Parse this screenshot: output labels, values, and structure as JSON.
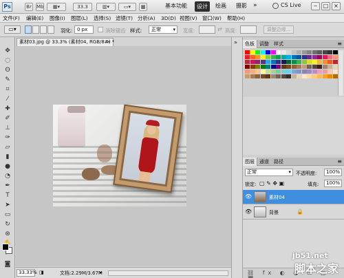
{
  "app": {
    "logo": "Ps"
  },
  "titlebar": {
    "zoom": "33.3",
    "workspaces": [
      "基本功能",
      "设计",
      "绘画",
      "摄影"
    ],
    "active_workspace": "设计",
    "overflow": "»",
    "cs_live": "CS Live",
    "controls": [
      "‒",
      "□",
      "×"
    ]
  },
  "menubar": {
    "items": [
      "文件(F)",
      "编辑(E)",
      "图像(I)",
      "图层(L)",
      "选择(S)",
      "滤镜(T)",
      "分析(A)",
      "3D(D)",
      "视图(V)",
      "窗口(W)",
      "帮助(H)"
    ]
  },
  "options": {
    "feather_label": "羽化:",
    "feather_value": "0 px",
    "antialias_label": "消除锯齿",
    "style_label": "样式:",
    "style_value": "正常",
    "width_label": "宽度:",
    "height_label": "高度:",
    "refine_edge": "调整边缘..."
  },
  "document": {
    "tab_title": "素材03.jpg @ 33.3% (素材04, RGB/8#) *",
    "zoom": "33.33%",
    "size": "文档:2.29M/3.67M"
  },
  "panels": {
    "swatch_tabs": [
      "色板",
      "调整",
      "样式"
    ],
    "swatch_colors": [
      "#ff0000",
      "#ffff00",
      "#00ff00",
      "#00ffff",
      "#0000ff",
      "#ff00ff",
      "#ffffff",
      "#ebebeb",
      "#d6d6d6",
      "#c2c2c2",
      "#adadad",
      "#999999",
      "#858585",
      "#707070",
      "#5c5c5c",
      "#474747",
      "#333333",
      "#000000",
      "#ee1d24",
      "#f26522",
      "#f7941d",
      "#fff200",
      "#8dc63f",
      "#39b54a",
      "#00a651",
      "#00a99d",
      "#00aeef",
      "#0072bc",
      "#0054a6",
      "#2e3192",
      "#662d91",
      "#92278f",
      "#9e005d",
      "#ed145b",
      "#f26d7d",
      "#f69679",
      "#c1272d",
      "#d4145a",
      "#9e1f63",
      "#662d91",
      "#29abe2",
      "#0071bc",
      "#2e3192",
      "#1b1464",
      "#006837",
      "#009245",
      "#39b54a",
      "#8cc63f",
      "#d9e021",
      "#fcee21",
      "#fbb03b",
      "#f7931e",
      "#f15a24",
      "#c1272d",
      "#7f0000",
      "#7f3f00",
      "#7f7f00",
      "#007f00",
      "#007f7f",
      "#00007f",
      "#7f007f",
      "#603813",
      "#754c24",
      "#8c6239",
      "#a67c52",
      "#c69c6d",
      "#736357",
      "#534741",
      "#42210b",
      "#998675",
      "#c7b299",
      "#e6d5b8",
      "#f7977a",
      "#f9ad81",
      "#fdc68a",
      "#fff79a",
      "#c4df9b",
      "#a2d39c",
      "#82ca9d",
      "#7bcdc8",
      "#6ecff6",
      "#7ea7d8",
      "#8493ca",
      "#8882be",
      "#a187be",
      "#bc8dbf",
      "#f49ac2",
      "#f6989d",
      "#fbc9b1",
      "#fde3c7",
      "#c69c6d",
      "#a67c52",
      "#8c6239",
      "#754c24",
      "#603813",
      "#998675",
      "#736357",
      "#534741",
      "#362f2d",
      "#c7b299",
      "#e6d5b8",
      "#ffe6c7",
      "#ffd9a8",
      "#ffcc80",
      "#ffb84d",
      "#ffa31a",
      "#e68a00",
      "#b36b00"
    ],
    "layer_tabs": [
      "图层",
      "通道",
      "路径"
    ],
    "blend_mode": "正常",
    "opacity_label": "不透明度:",
    "opacity_value": "100%",
    "lock_label": "锁定:",
    "fill_label": "填充:",
    "fill_value": "100%",
    "layers": [
      {
        "name": "素材04",
        "selected": true
      },
      {
        "name": "背景",
        "selected": false
      }
    ]
  },
  "watermark": {
    "site": "jb51.net",
    "name": "脚本之家"
  }
}
